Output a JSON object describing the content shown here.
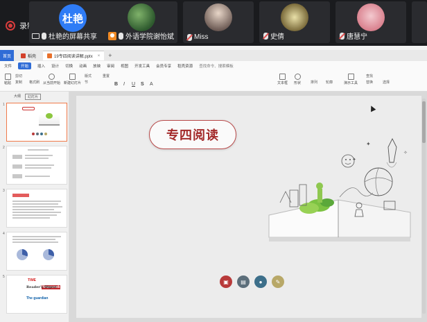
{
  "meeting": {
    "recording_label": "录制中",
    "participants": [
      {
        "avatar_text": "杜艳",
        "name": "杜艳的屏幕共享",
        "icon": "screen-share-icon",
        "mic": "on"
      },
      {
        "name": "外语学院谢怡斌",
        "icon": "user-icon",
        "mic": "on"
      },
      {
        "name": "Miss",
        "mic": "muted"
      },
      {
        "name": "史倩",
        "mic": "muted"
      },
      {
        "name": "唐慧宁",
        "mic": "muted"
      }
    ]
  },
  "app": {
    "tabs": [
      {
        "label": "首页"
      },
      {
        "label": "稻壳"
      },
      {
        "label": "19专四阅读讲解.pptx"
      }
    ],
    "menu": [
      "文件",
      "开始",
      "插入",
      "设计",
      "切换",
      "动画",
      "放映",
      "审阅",
      "视图",
      "开发工具",
      "会员专享",
      "稻壳资源",
      "查找命令、搜索模板"
    ],
    "active_menu": "开始",
    "toolbar": [
      "粘贴",
      "剪切",
      "复制",
      "格式刷",
      "从当前开始",
      "新建幻灯片",
      "版式",
      "节",
      "重置",
      "文本框",
      "形状",
      "排列",
      "轮廓",
      "演示工具",
      "查找",
      "替换",
      "选择"
    ]
  },
  "thumbnails": {
    "tabs": [
      "大纲",
      "幻灯片"
    ],
    "active_tab": "幻灯片",
    "slides": [
      {
        "number": "1",
        "title": "专四阅读"
      },
      {
        "number": "2"
      },
      {
        "number": "3"
      },
      {
        "number": "4"
      },
      {
        "number": "5",
        "logos": [
          "TIME",
          "Newsweek",
          "Reader's Digest",
          "The guardian"
        ]
      }
    ],
    "selected": "1"
  },
  "slide": {
    "title": "专四阅读"
  },
  "colors": {
    "accent": "#2f6cd6",
    "slide_title": "#a32a2a",
    "circle_1": "#b83a3a",
    "circle_2": "#5c6e7a",
    "circle_3": "#3d6f8a",
    "circle_4": "#b8a868"
  }
}
